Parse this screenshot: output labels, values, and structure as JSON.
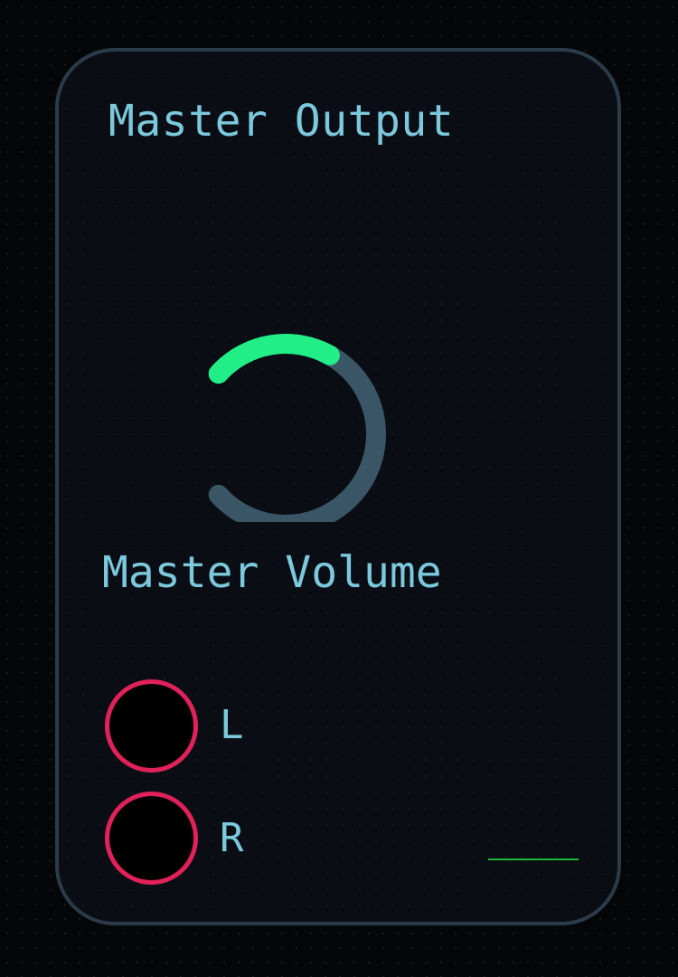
{
  "module": {
    "title": "Master Output"
  },
  "volume": {
    "label": "Master Volume",
    "level": 0.28,
    "accent_color": "#22ee88",
    "track_color": "#3a5566"
  },
  "outputs": [
    {
      "label": "L",
      "jack_color": "#e0215a"
    },
    {
      "label": "R",
      "jack_color": "#e0215a"
    }
  ],
  "meter": {
    "color": "#1fb43a"
  }
}
